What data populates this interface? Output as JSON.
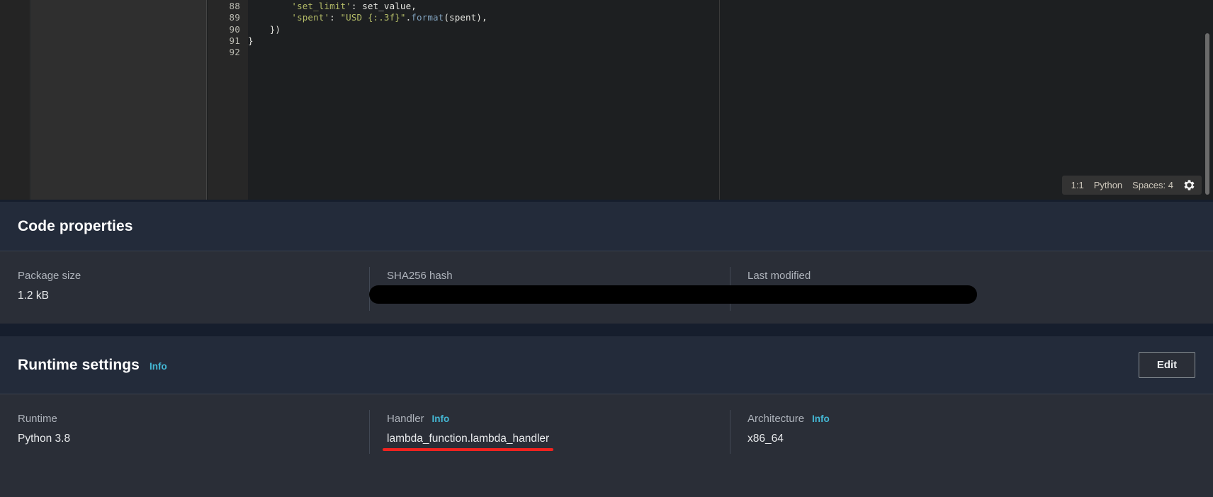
{
  "editor": {
    "lines": [
      {
        "number": "88",
        "tokens": [
          {
            "t": "        ",
            "c": "pln"
          },
          {
            "t": "'set_limit'",
            "c": "str"
          },
          {
            "t": ": set_value,",
            "c": "pln"
          }
        ]
      },
      {
        "number": "89",
        "tokens": [
          {
            "t": "        ",
            "c": "pln"
          },
          {
            "t": "'spent'",
            "c": "str"
          },
          {
            "t": ": ",
            "c": "pln"
          },
          {
            "t": "\"USD {:.3f}\"",
            "c": "str"
          },
          {
            "t": ".",
            "c": "pln"
          },
          {
            "t": "format",
            "c": "fn"
          },
          {
            "t": "(spent),",
            "c": "pln"
          }
        ]
      },
      {
        "number": "90",
        "tokens": [
          {
            "t": "    })",
            "c": "pln"
          }
        ]
      },
      {
        "number": "91",
        "tokens": [
          {
            "t": "}",
            "c": "pln"
          }
        ]
      },
      {
        "number": "92",
        "tokens": [
          {
            "t": "",
            "c": "pln"
          }
        ]
      }
    ],
    "status_bar": {
      "cursor_position": "1:1",
      "language": "Python",
      "indentation": "Spaces: 4",
      "settings_icon": "gear-icon"
    }
  },
  "code_properties": {
    "title": "Code properties",
    "columns": [
      {
        "label": "Package size",
        "value": "1.2 kB",
        "redacted": false
      },
      {
        "label": "SHA256 hash",
        "value": "",
        "redacted": true
      },
      {
        "label": "Last modified",
        "value": "",
        "redacted": true
      }
    ]
  },
  "runtime_settings": {
    "title": "Runtime settings",
    "info_label": "Info",
    "edit_label": "Edit",
    "columns": [
      {
        "label": "Runtime",
        "info": "",
        "value": "Python 3.8",
        "highlighted": false
      },
      {
        "label": "Handler",
        "info": "Info",
        "value": "lambda_function.lambda_handler",
        "highlighted": true
      },
      {
        "label": "Architecture",
        "info": "Info",
        "value": "x86_64",
        "highlighted": false
      }
    ]
  },
  "colors": {
    "accent_link": "#44b9d6",
    "annotation_underline": "#f0231f",
    "panel_background": "#2a2e37",
    "panel_header_background": "#232b3a",
    "page_background": "#161e2d",
    "editor_background": "#1d1f21"
  }
}
